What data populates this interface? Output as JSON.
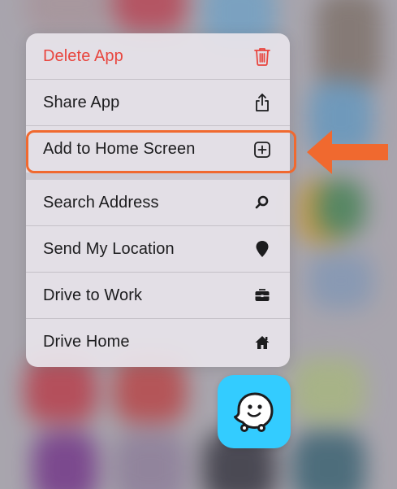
{
  "menu": {
    "items": [
      {
        "label": "Delete App",
        "icon": "trash-icon",
        "destructive": true
      },
      {
        "label": "Share App",
        "icon": "share-icon"
      },
      {
        "label": "Add to Home Screen",
        "icon": "plus-square-icon"
      },
      {
        "label": "Search Address",
        "icon": "search-icon"
      },
      {
        "label": "Send My Location",
        "icon": "location-pin-icon"
      },
      {
        "label": "Drive to Work",
        "icon": "briefcase-icon"
      },
      {
        "label": "Drive Home",
        "icon": "home-icon"
      }
    ]
  },
  "app": {
    "name": "Waze",
    "icon": "waze-icon",
    "color": "#33ccff"
  },
  "annotation": {
    "highlighted_item": "Add to Home Screen",
    "color": "#f0692f"
  },
  "colors": {
    "destructive": "#e8463f",
    "text": "#1c1c1e"
  }
}
